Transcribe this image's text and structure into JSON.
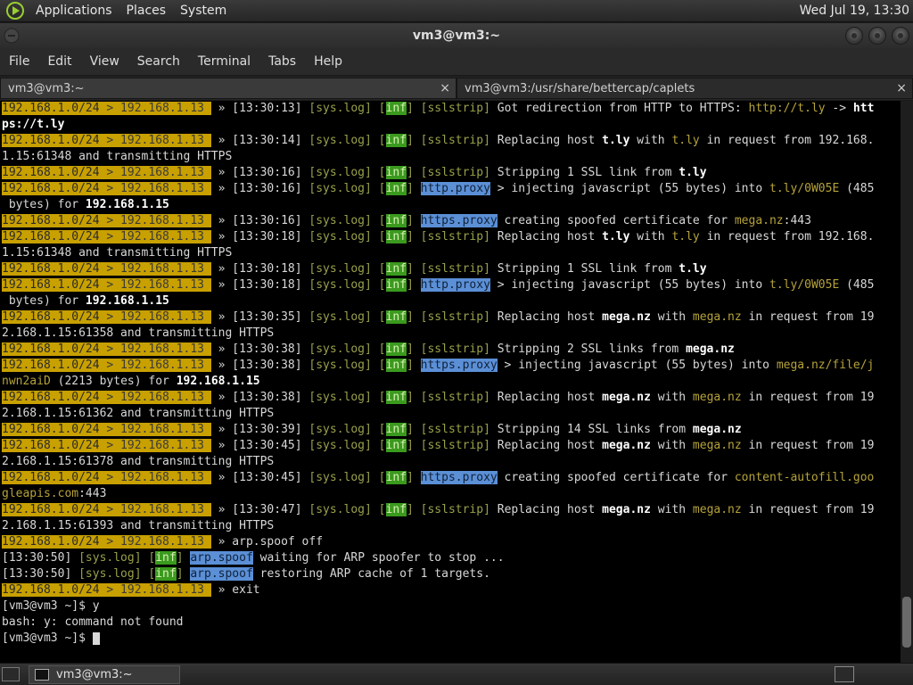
{
  "top_panel": {
    "menus": [
      "Applications",
      "Places",
      "System"
    ],
    "clock": "Wed Jul 19, 13:30"
  },
  "window": {
    "title": "vm3@vm3:~"
  },
  "menubar": [
    "File",
    "Edit",
    "View",
    "Search",
    "Terminal",
    "Tabs",
    "Help"
  ],
  "tabs": [
    {
      "label": "vm3@vm3:~",
      "close": "×",
      "active": true
    },
    {
      "label": "vm3@vm3:/usr/share/bettercap/caplets",
      "close": "×",
      "active": false
    }
  ],
  "scrollbar": {
    "position": 0.97,
    "visible_fraction": 0.09
  },
  "taskbar": {
    "window_button": "vm3@vm3:~"
  },
  "terminal_lines": [
    [
      [
        "sub",
        "192.168.1.0/24"
      ],
      [
        "ip",
        " > 192.168.1.13 "
      ],
      [
        "t",
        " » [13:30:13] "
      ],
      [
        "log",
        "[sys.log]"
      ],
      [
        "t",
        " "
      ],
      [
        "log",
        "["
      ],
      [
        "inf",
        "inf"
      ],
      [
        "log",
        "]"
      ],
      [
        "t",
        " "
      ],
      [
        "mod",
        "[sslstrip]"
      ],
      [
        "t",
        " Got redirection from HTTP to HTTPS: "
      ],
      [
        "y",
        "http://t.ly"
      ],
      [
        "t",
        " -> "
      ],
      [
        "b",
        "htt"
      ]
    ],
    [
      [
        "b",
        "ps://t.ly"
      ]
    ],
    [
      [
        "sub",
        "192.168.1.0/24"
      ],
      [
        "ip",
        " > 192.168.1.13 "
      ],
      [
        "t",
        " » [13:30:14] "
      ],
      [
        "log",
        "[sys.log]"
      ],
      [
        "t",
        " "
      ],
      [
        "log",
        "["
      ],
      [
        "inf",
        "inf"
      ],
      [
        "log",
        "]"
      ],
      [
        "t",
        " "
      ],
      [
        "mod",
        "[sslstrip]"
      ],
      [
        "t",
        " Replacing host "
      ],
      [
        "b",
        "t.ly"
      ],
      [
        "t",
        " with "
      ],
      [
        "y",
        "t.ly"
      ],
      [
        "t",
        " in request from 192.168."
      ]
    ],
    [
      [
        "t",
        "1.15:61348 and transmitting HTTPS"
      ]
    ],
    [
      [
        "sub",
        "192.168.1.0/24"
      ],
      [
        "ip",
        " > 192.168.1.13 "
      ],
      [
        "t",
        " » [13:30:16] "
      ],
      [
        "log",
        "[sys.log]"
      ],
      [
        "t",
        " "
      ],
      [
        "log",
        "["
      ],
      [
        "inf",
        "inf"
      ],
      [
        "log",
        "]"
      ],
      [
        "t",
        " "
      ],
      [
        "mod",
        "[sslstrip]"
      ],
      [
        "t",
        " Stripping 1 SSL link from "
      ],
      [
        "b",
        "t.ly"
      ]
    ],
    [
      [
        "sub",
        "192.168.1.0/24"
      ],
      [
        "ip",
        " > 192.168.1.13 "
      ],
      [
        "t",
        " » [13:30:16] "
      ],
      [
        "log",
        "[sys.log]"
      ],
      [
        "t",
        " "
      ],
      [
        "log",
        "["
      ],
      [
        "inf",
        "inf"
      ],
      [
        "log",
        "]"
      ],
      [
        "t",
        " "
      ],
      [
        "mod2",
        "http.proxy"
      ],
      [
        "t",
        " > injecting javascript (55 bytes) into "
      ],
      [
        "y",
        "t.ly/0W05E"
      ],
      [
        "t",
        " (485"
      ]
    ],
    [
      [
        "t",
        " bytes) for "
      ],
      [
        "b",
        "192.168.1.15"
      ]
    ],
    [
      [
        "sub",
        "192.168.1.0/24"
      ],
      [
        "ip",
        " > 192.168.1.13 "
      ],
      [
        "t",
        " » [13:30:16] "
      ],
      [
        "log",
        "[sys.log]"
      ],
      [
        "t",
        " "
      ],
      [
        "log",
        "["
      ],
      [
        "inf",
        "inf"
      ],
      [
        "log",
        "]"
      ],
      [
        "t",
        " "
      ],
      [
        "mod2",
        "https.proxy"
      ],
      [
        "t",
        " creating spoofed certificate for "
      ],
      [
        "y",
        "mega.nz"
      ],
      [
        "t",
        ":443"
      ]
    ],
    [
      [
        "sub",
        "192.168.1.0/24"
      ],
      [
        "ip",
        " > 192.168.1.13 "
      ],
      [
        "t",
        " » [13:30:18] "
      ],
      [
        "log",
        "[sys.log]"
      ],
      [
        "t",
        " "
      ],
      [
        "log",
        "["
      ],
      [
        "inf",
        "inf"
      ],
      [
        "log",
        "]"
      ],
      [
        "t",
        " "
      ],
      [
        "mod",
        "[sslstrip]"
      ],
      [
        "t",
        " Replacing host "
      ],
      [
        "b",
        "t.ly"
      ],
      [
        "t",
        " with "
      ],
      [
        "y",
        "t.ly"
      ],
      [
        "t",
        " in request from 192.168."
      ]
    ],
    [
      [
        "t",
        "1.15:61348 and transmitting HTTPS"
      ]
    ],
    [
      [
        "sub",
        "192.168.1.0/24"
      ],
      [
        "ip",
        " > 192.168.1.13 "
      ],
      [
        "t",
        " » [13:30:18] "
      ],
      [
        "log",
        "[sys.log]"
      ],
      [
        "t",
        " "
      ],
      [
        "log",
        "["
      ],
      [
        "inf",
        "inf"
      ],
      [
        "log",
        "]"
      ],
      [
        "t",
        " "
      ],
      [
        "mod",
        "[sslstrip]"
      ],
      [
        "t",
        " Stripping 1 SSL link from "
      ],
      [
        "b",
        "t.ly"
      ]
    ],
    [
      [
        "sub",
        "192.168.1.0/24"
      ],
      [
        "ip",
        " > 192.168.1.13 "
      ],
      [
        "t",
        " » [13:30:18] "
      ],
      [
        "log",
        "[sys.log]"
      ],
      [
        "t",
        " "
      ],
      [
        "log",
        "["
      ],
      [
        "inf",
        "inf"
      ],
      [
        "log",
        "]"
      ],
      [
        "t",
        " "
      ],
      [
        "mod2",
        "http.proxy"
      ],
      [
        "t",
        " > injecting javascript (55 bytes) into "
      ],
      [
        "y",
        "t.ly/0W05E"
      ],
      [
        "t",
        " (485"
      ]
    ],
    [
      [
        "t",
        " bytes) for "
      ],
      [
        "b",
        "192.168.1.15"
      ]
    ],
    [
      [
        "sub",
        "192.168.1.0/24"
      ],
      [
        "ip",
        " > 192.168.1.13 "
      ],
      [
        "t",
        " » [13:30:35] "
      ],
      [
        "log",
        "[sys.log]"
      ],
      [
        "t",
        " "
      ],
      [
        "log",
        "["
      ],
      [
        "inf",
        "inf"
      ],
      [
        "log",
        "]"
      ],
      [
        "t",
        " "
      ],
      [
        "mod",
        "[sslstrip]"
      ],
      [
        "t",
        " Replacing host "
      ],
      [
        "b",
        "mega.nz"
      ],
      [
        "t",
        " with "
      ],
      [
        "y",
        "mega.nz"
      ],
      [
        "t",
        " in request from 19"
      ]
    ],
    [
      [
        "t",
        "2.168.1.15:61358 and transmitting HTTPS"
      ]
    ],
    [
      [
        "sub",
        "192.168.1.0/24"
      ],
      [
        "ip",
        " > 192.168.1.13 "
      ],
      [
        "t",
        " » [13:30:38] "
      ],
      [
        "log",
        "[sys.log]"
      ],
      [
        "t",
        " "
      ],
      [
        "log",
        "["
      ],
      [
        "inf",
        "inf"
      ],
      [
        "log",
        "]"
      ],
      [
        "t",
        " "
      ],
      [
        "mod",
        "[sslstrip]"
      ],
      [
        "t",
        " Stripping 2 SSL links from "
      ],
      [
        "b",
        "mega.nz"
      ]
    ],
    [
      [
        "sub",
        "192.168.1.0/24"
      ],
      [
        "ip",
        " > 192.168.1.13 "
      ],
      [
        "t",
        " » [13:30:38] "
      ],
      [
        "log",
        "[sys.log]"
      ],
      [
        "t",
        " "
      ],
      [
        "log",
        "["
      ],
      [
        "inf",
        "inf"
      ],
      [
        "log",
        "]"
      ],
      [
        "t",
        " "
      ],
      [
        "mod2",
        "https.proxy"
      ],
      [
        "t",
        " > injecting javascript (55 bytes) into "
      ],
      [
        "y",
        "mega.nz/file/j"
      ]
    ],
    [
      [
        "y",
        "nwn2aiD"
      ],
      [
        "t",
        " (2213 bytes) for "
      ],
      [
        "b",
        "192.168.1.15"
      ]
    ],
    [
      [
        "sub",
        "192.168.1.0/24"
      ],
      [
        "ip",
        " > 192.168.1.13 "
      ],
      [
        "t",
        " » [13:30:38] "
      ],
      [
        "log",
        "[sys.log]"
      ],
      [
        "t",
        " "
      ],
      [
        "log",
        "["
      ],
      [
        "inf",
        "inf"
      ],
      [
        "log",
        "]"
      ],
      [
        "t",
        " "
      ],
      [
        "mod",
        "[sslstrip]"
      ],
      [
        "t",
        " Replacing host "
      ],
      [
        "b",
        "mega.nz"
      ],
      [
        "t",
        " with "
      ],
      [
        "y",
        "mega.nz"
      ],
      [
        "t",
        " in request from 19"
      ]
    ],
    [
      [
        "t",
        "2.168.1.15:61362 and transmitting HTTPS"
      ]
    ],
    [
      [
        "sub",
        "192.168.1.0/24"
      ],
      [
        "ip",
        " > 192.168.1.13 "
      ],
      [
        "t",
        " » [13:30:39] "
      ],
      [
        "log",
        "[sys.log]"
      ],
      [
        "t",
        " "
      ],
      [
        "log",
        "["
      ],
      [
        "inf",
        "inf"
      ],
      [
        "log",
        "]"
      ],
      [
        "t",
        " "
      ],
      [
        "mod",
        "[sslstrip]"
      ],
      [
        "t",
        " Stripping 14 SSL links from "
      ],
      [
        "b",
        "mega.nz"
      ]
    ],
    [
      [
        "sub",
        "192.168.1.0/24"
      ],
      [
        "ip",
        " > 192.168.1.13 "
      ],
      [
        "t",
        " » [13:30:45] "
      ],
      [
        "log",
        "[sys.log]"
      ],
      [
        "t",
        " "
      ],
      [
        "log",
        "["
      ],
      [
        "inf",
        "inf"
      ],
      [
        "log",
        "]"
      ],
      [
        "t",
        " "
      ],
      [
        "mod",
        "[sslstrip]"
      ],
      [
        "t",
        " Replacing host "
      ],
      [
        "b",
        "mega.nz"
      ],
      [
        "t",
        " with "
      ],
      [
        "y",
        "mega.nz"
      ],
      [
        "t",
        " in request from 19"
      ]
    ],
    [
      [
        "t",
        "2.168.1.15:61378 and transmitting HTTPS"
      ]
    ],
    [
      [
        "sub",
        "192.168.1.0/24"
      ],
      [
        "ip",
        " > 192.168.1.13 "
      ],
      [
        "t",
        " » [13:30:45] "
      ],
      [
        "log",
        "[sys.log]"
      ],
      [
        "t",
        " "
      ],
      [
        "log",
        "["
      ],
      [
        "inf",
        "inf"
      ],
      [
        "log",
        "]"
      ],
      [
        "t",
        " "
      ],
      [
        "mod2",
        "https.proxy"
      ],
      [
        "t",
        " creating spoofed certificate for "
      ],
      [
        "y",
        "content-autofill.goo"
      ]
    ],
    [
      [
        "y",
        "gleapis.com"
      ],
      [
        "t",
        ":443"
      ]
    ],
    [
      [
        "sub",
        "192.168.1.0/24"
      ],
      [
        "ip",
        " > 192.168.1.13 "
      ],
      [
        "t",
        " » [13:30:47] "
      ],
      [
        "log",
        "[sys.log]"
      ],
      [
        "t",
        " "
      ],
      [
        "log",
        "["
      ],
      [
        "inf",
        "inf"
      ],
      [
        "log",
        "]"
      ],
      [
        "t",
        " "
      ],
      [
        "mod",
        "[sslstrip]"
      ],
      [
        "t",
        " Replacing host "
      ],
      [
        "b",
        "mega.nz"
      ],
      [
        "t",
        " with "
      ],
      [
        "y",
        "mega.nz"
      ],
      [
        "t",
        " in request from 19"
      ]
    ],
    [
      [
        "t",
        "2.168.1.15:61393 and transmitting HTTPS"
      ]
    ],
    [
      [
        "sub",
        "192.168.1.0/24"
      ],
      [
        "ip",
        " > 192.168.1.13 "
      ],
      [
        "t",
        " » arp.spoof off"
      ]
    ],
    [
      [
        "t",
        "[13:30:50] "
      ],
      [
        "log",
        "[sys.log]"
      ],
      [
        "t",
        " "
      ],
      [
        "log",
        "["
      ],
      [
        "inf",
        "inf"
      ],
      [
        "log",
        "]"
      ],
      [
        "t",
        " "
      ],
      [
        "mod2",
        "arp.spoof"
      ],
      [
        "t",
        " waiting for ARP spoofer to stop ..."
      ]
    ],
    [
      [
        "t",
        "[13:30:50] "
      ],
      [
        "log",
        "[sys.log]"
      ],
      [
        "t",
        " "
      ],
      [
        "log",
        "["
      ],
      [
        "inf",
        "inf"
      ],
      [
        "log",
        "]"
      ],
      [
        "t",
        " "
      ],
      [
        "mod2",
        "arp.spoof"
      ],
      [
        "t",
        " restoring ARP cache of 1 targets."
      ]
    ],
    [
      [
        "sub",
        "192.168.1.0/24"
      ],
      [
        "ip",
        " > 192.168.1.13 "
      ],
      [
        "t",
        " » exit"
      ]
    ],
    [
      [
        "t",
        "[vm3@vm3 ~]$ y"
      ]
    ],
    [
      [
        "t",
        "bash: y: command not found"
      ]
    ],
    [
      [
        "t",
        "[vm3@vm3 ~]$ "
      ]
    ]
  ]
}
